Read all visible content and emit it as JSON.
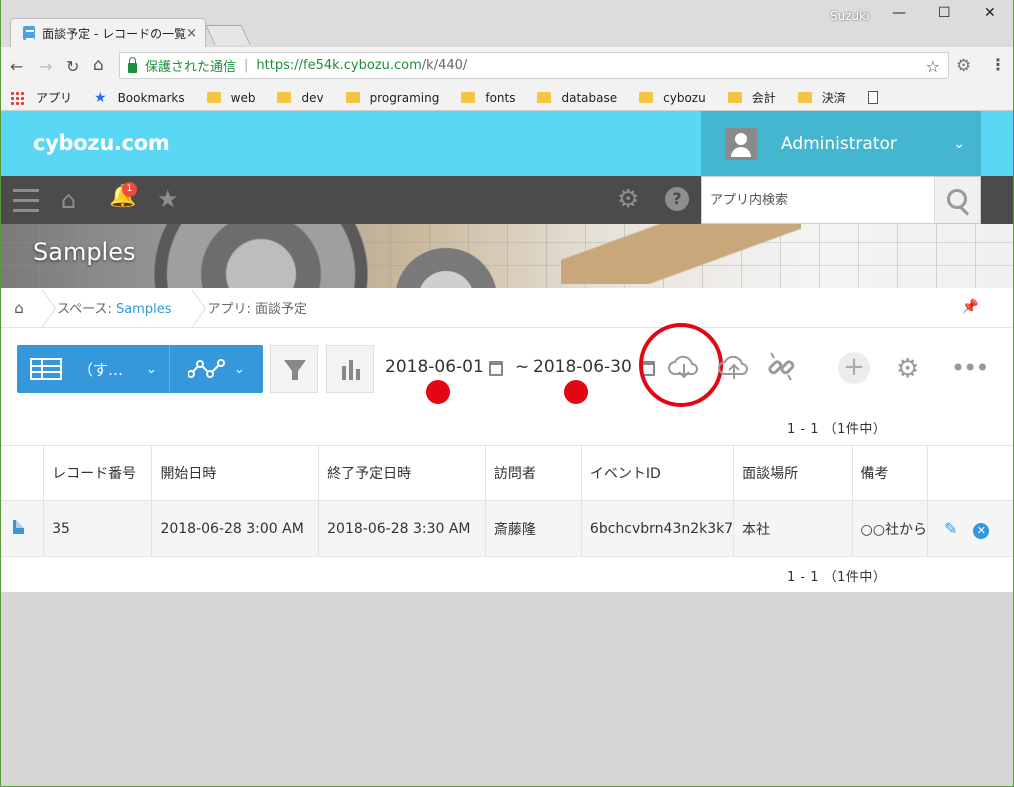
{
  "browser": {
    "tab_title": "面談予定 - レコードの一覧",
    "tab_close": "×",
    "user_name": "Suzuki",
    "win_min": "—",
    "win_max": "☐",
    "win_close": "✕",
    "secure_text": "保護された通信",
    "separator": "|",
    "url_host": "https://fe54k.cybozu.com",
    "url_path": "/k/440/",
    "bookmarks": {
      "apps": "アプリ",
      "bookmarks": "Bookmarks",
      "web": "web",
      "dev": "dev",
      "programing": "programing",
      "fonts": "fonts",
      "database": "database",
      "cybozu": "cybozu",
      "kaikei": "会計",
      "kessai": "決済"
    }
  },
  "header": {
    "logo": "cybozu.com",
    "user": "Administrator",
    "notification_count": "1",
    "search_placeholder": "アプリ内検索"
  },
  "banner": {
    "space_title": "Samples"
  },
  "breadcrumb": {
    "space_prefix": "スペース: ",
    "space_name": "Samples",
    "app_prefix": "アプリ: ",
    "app_name": "面談予定"
  },
  "toolbar": {
    "view_name": "（す…",
    "date_from": "2018-06-01",
    "date_separator": "~",
    "date_to": "2018-06-30",
    "pager_top": "1 - 1 （1件中）",
    "pager_bottom": "1 - 1 （1件中）"
  },
  "table": {
    "columns": [
      "レコード番号",
      "開始日時",
      "終了予定日時",
      "訪問者",
      "イベントID",
      "面談場所",
      "備考"
    ],
    "rows": [
      {
        "record_no": "35",
        "start": "2018-06-28 3:00 AM",
        "end": "2018-06-28 3:30 AM",
        "visitor": "斎藤隆",
        "event_id": "6bchcvbrn43n2k3k7",
        "place": "本社",
        "note": "○○社から"
      }
    ]
  },
  "colors": {
    "header_bg": "#59d7f5",
    "accent": "#3498db",
    "annotation_red": "#e30613",
    "toolbar_dark": "#4b4b4b"
  },
  "icons": [
    "hamburger-icon",
    "home-icon",
    "bell-icon",
    "star-icon",
    "gear-icon",
    "help-icon",
    "search-icon",
    "filter-icon",
    "chart-icon",
    "calendar-icon",
    "cloud-download-icon",
    "cloud-upload-icon",
    "unlink-icon",
    "plus-icon",
    "more-icon",
    "pin-icon",
    "edit-icon",
    "delete-icon"
  ]
}
